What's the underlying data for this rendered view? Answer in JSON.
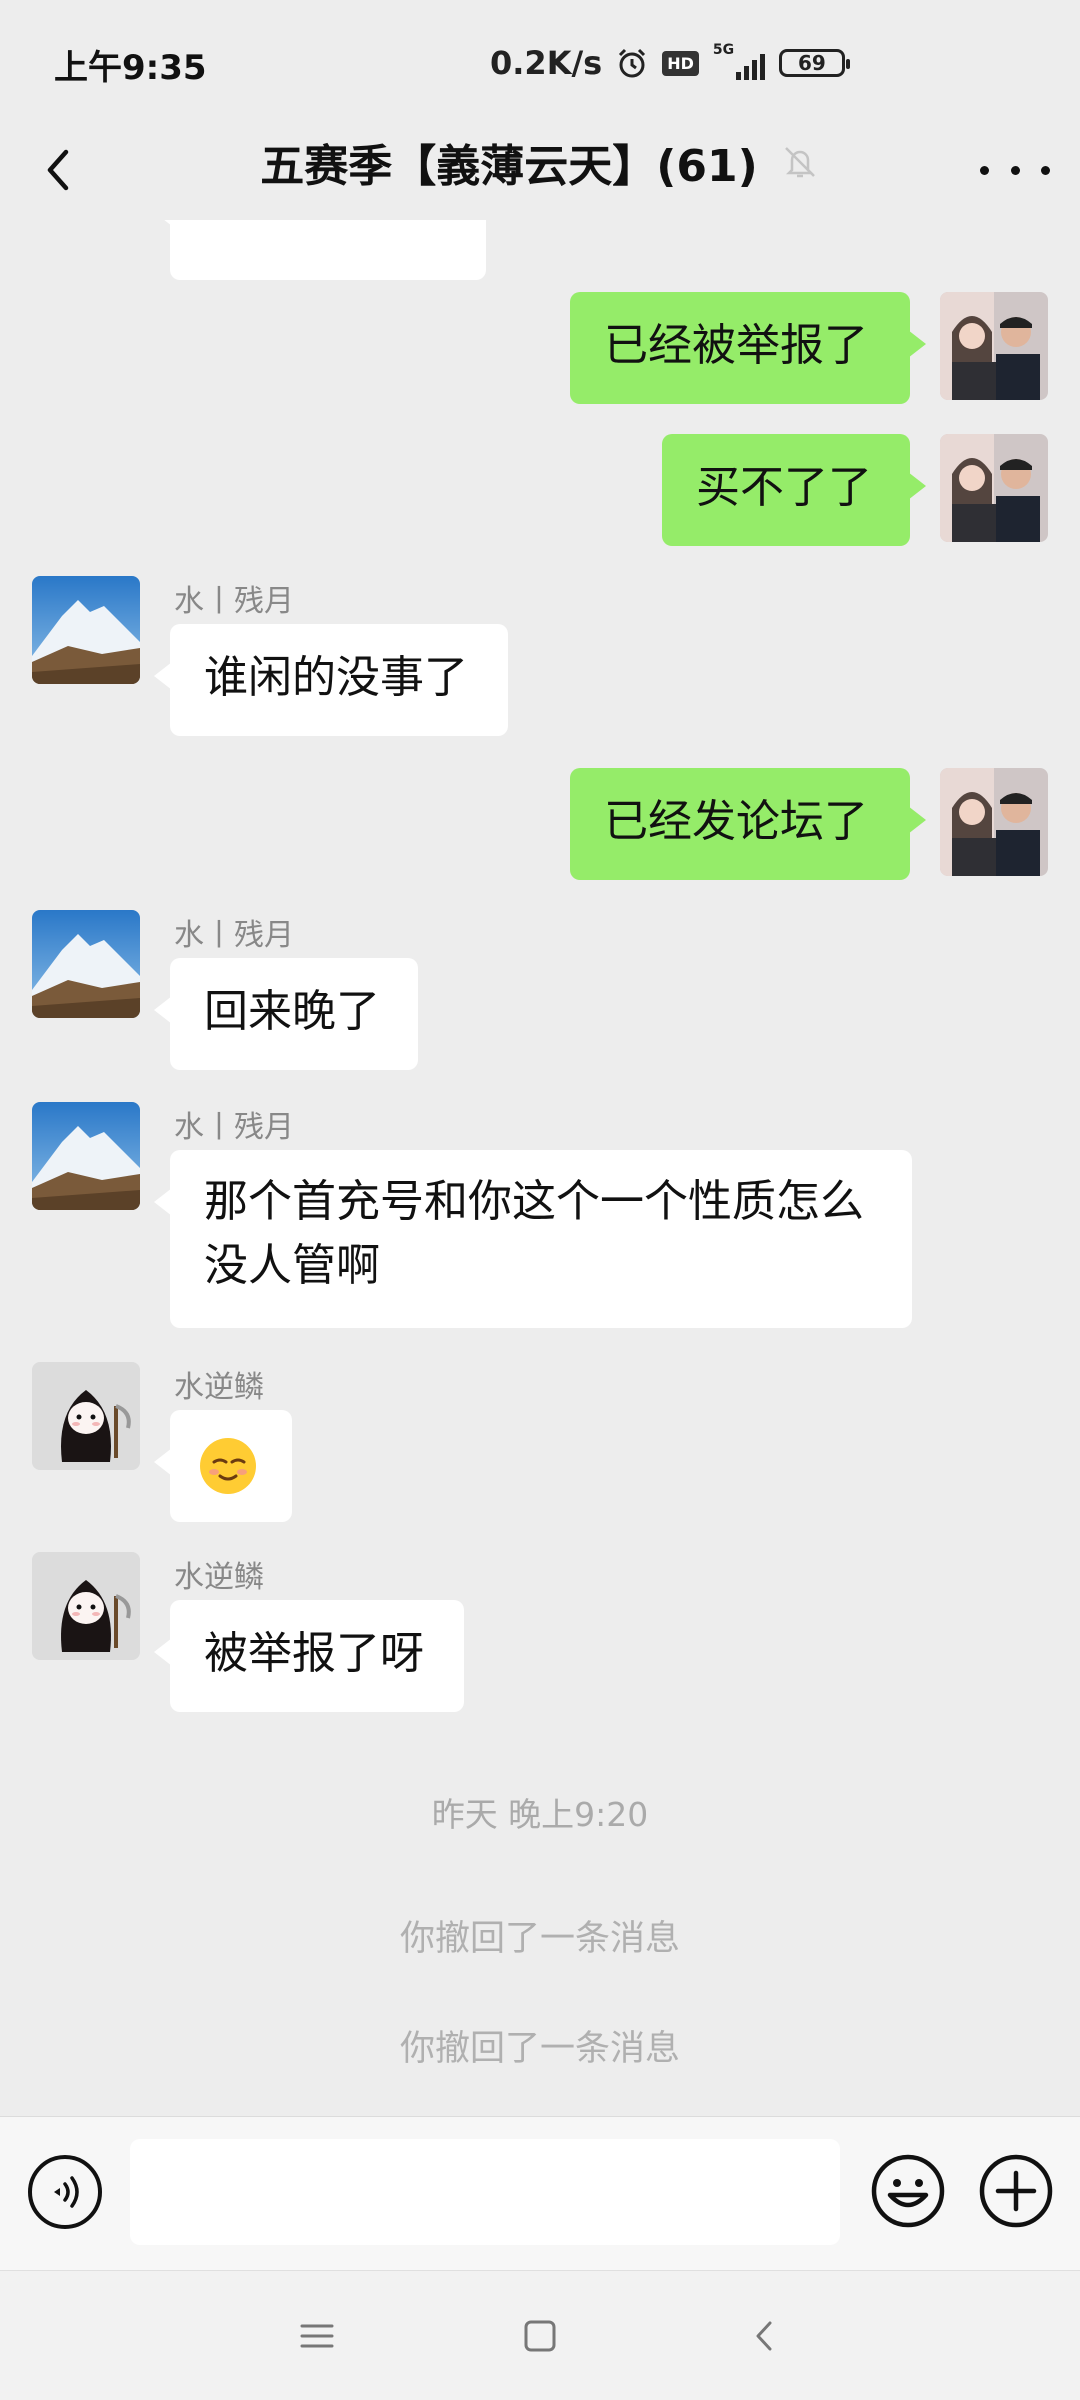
{
  "status_bar": {
    "time": "上午9:35",
    "net_speed": "0.2K/s",
    "hd": "HD",
    "network": "5G",
    "battery": "69"
  },
  "header": {
    "title": "五赛季【義薄云天】(61)"
  },
  "messages": [
    {
      "side": "in",
      "sender": "",
      "text": "",
      "partial": true
    },
    {
      "side": "out",
      "text": "已经被举报了"
    },
    {
      "side": "out",
      "text": "买不了了"
    },
    {
      "side": "in",
      "sender": "水丨残月",
      "text": "谁闲的没事了"
    },
    {
      "side": "out",
      "text": "已经发论坛了"
    },
    {
      "side": "in",
      "sender": "水丨残月",
      "text": "回来晚了"
    },
    {
      "side": "in",
      "sender": "水丨残月",
      "text_line1": "那个首充号和你这个一个性质怎么",
      "text_line2": "没人管啊"
    },
    {
      "side": "in",
      "sender": "水逆鳞",
      "emoji": "🥲"
    },
    {
      "side": "in",
      "sender": "水逆鳞",
      "text": "被举报了呀"
    }
  ],
  "system": {
    "timestamp": "昨天 晚上9:20",
    "recall_1": "你撤回了一条消息",
    "recall_2": "你撤回了一条消息"
  },
  "input": {
    "value": "",
    "placeholder": ""
  },
  "colors": {
    "background": "#ededed",
    "bubble_out": "#95ec69",
    "bubble_in": "#ffffff",
    "sender_gray": "#888888",
    "system_gray": "#aaaaaa"
  },
  "icons": [
    "back-icon",
    "mute-bell-icon",
    "more-icon",
    "voice-icon",
    "emoji-icon",
    "plus-icon",
    "menu-icon",
    "home-icon",
    "back-nav-icon"
  ]
}
